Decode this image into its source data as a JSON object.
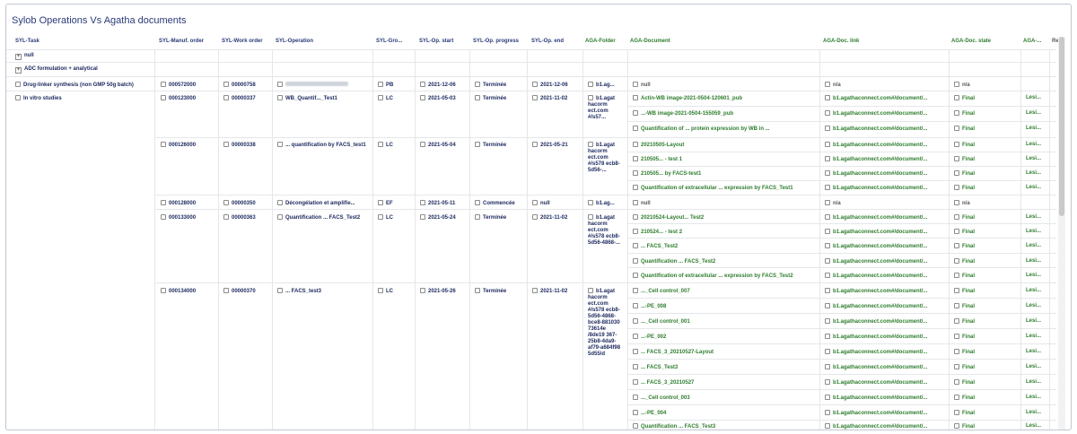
{
  "title": "Sylob Operations Vs Agatha documents",
  "columns": [
    {
      "label": "SYL-Task",
      "group": "syl"
    },
    {
      "label": "SYL-Manuf. order",
      "group": "syl"
    },
    {
      "label": "SYL-Work order",
      "group": "syl"
    },
    {
      "label": "SYL-Operation",
      "group": "syl"
    },
    {
      "label": "SYL-Gro...",
      "group": "syl"
    },
    {
      "label": "SYL-Op. start",
      "group": "syl"
    },
    {
      "label": "SYL-Op. progress",
      "group": "syl"
    },
    {
      "label": "SYL-Op. end",
      "group": "syl"
    },
    {
      "label": "AGA-Folder",
      "group": "aga"
    },
    {
      "label": "AGA-Document",
      "group": "aga"
    },
    {
      "label": "AGA-Doc. link",
      "group": "aga"
    },
    {
      "label": "AGA-Doc. state",
      "group": "aga"
    },
    {
      "label": "AGA-...",
      "group": "aga"
    },
    {
      "label": "Re...",
      "group": "aga"
    }
  ],
  "tasks": {
    "null_row": "null",
    "adc": "ADC formulation + analytical",
    "drug_linker": "Drug-linker synthesis (non GMP 50g batch)",
    "in_vitro": "In vitro studies"
  },
  "rows": [
    {
      "mo": "000572000",
      "wo": "00000758",
      "op": "",
      "grp": "PB",
      "start": "2021-12-06",
      "progress": "Terminée",
      "end": "2021-12-06",
      "folder": "b1.ag...",
      "doc": "null",
      "link": "n/a",
      "state": "n/a",
      "extra": ""
    },
    {
      "mo": "000123000",
      "wo": "00000337",
      "op": "WB_Quantif..._Test1",
      "grp": "LC",
      "start": "2021-05-03",
      "progress": "Terminée",
      "end": "2021-11-02",
      "folder": "b1.agat hacorm ect.com #/s57...",
      "docs": [
        "Actin-WB image-2021-0504-120601_pub",
        "...-WB image-2021-0504-155059_pub",
        "Quantification of ... protein expression by WB in ..."
      ],
      "link": "b1.agathaconnect.com#/document/...",
      "state": "Final",
      "extra": "Lesi..."
    },
    {
      "mo": "000126000",
      "wo": "00000338",
      "op": "... quantification by FACS_test1",
      "grp": "LC",
      "start": "2021-05-04",
      "progress": "Terminée",
      "end": "2021-05-21",
      "folder": "b1.agat hacorm ect.com #/s578 ecb8-5d56-...",
      "docs": [
        "20210505-Layout",
        "210505... - test 1",
        "210505... by FACS-test1",
        "Quantification of extracellular ... expression by FACS_Test1"
      ],
      "link": "b1.agathaconnect.com#/document/...",
      "state": "Final",
      "extra": "Lesi..."
    },
    {
      "mo": "000128000",
      "wo": "00000350",
      "op": "Décongélation et amplifie...",
      "grp": "EF",
      "start": "2021-05-11",
      "progress": "Commencée",
      "end": "null",
      "folder": "b1.ag...",
      "doc": "null",
      "link": "n/a",
      "state": "n/a",
      "extra": ""
    },
    {
      "mo": "000133000",
      "wo": "00000363",
      "op": "Quantification ... FACS_Test2",
      "grp": "LC",
      "start": "2021-05-24",
      "progress": "Terminée",
      "end": "2021-11-02",
      "folder": "b1.agat hacorm ect.com #/s578 ecb8-5d56-4868-...",
      "docs": [
        "20210524-Layout... Test2",
        "210524... - test 2",
        "... FACS_Test2",
        "Quantification ... FACS_Test2",
        "Quantification of extracellular ... expression by FACS_Test2"
      ],
      "link": "b1.agathaconnect.com#/document/...",
      "state": "Final",
      "extra": "Lesi..."
    },
    {
      "mo": "000134000",
      "wo": "00000370",
      "op": "... FACS_test3",
      "grp": "LC",
      "start": "2021-05-26",
      "progress": "Terminée",
      "end": "2021-11-02",
      "folder": "b1.agat hacorm ect.com #/s578 ecb8-5d56-4868-bce8-881030 73614e /8de19 367-25b8-4da9-af79-a684f98 5d55/d",
      "docs": [
        "..._Cell control_007",
        "...-PE_008",
        "..._Cell control_001",
        "...-PE_002",
        "... FACS_3_20210527-Layout",
        "... FACS_Test3",
        "... FACS_3_20210527",
        "..._Cell control_003",
        "...-PE_004",
        "Quantification ... FACS_Test3"
      ],
      "link": "b1.agathaconnect.com#/document/...",
      "state": "Final",
      "extra": "Lesi..."
    }
  ]
}
